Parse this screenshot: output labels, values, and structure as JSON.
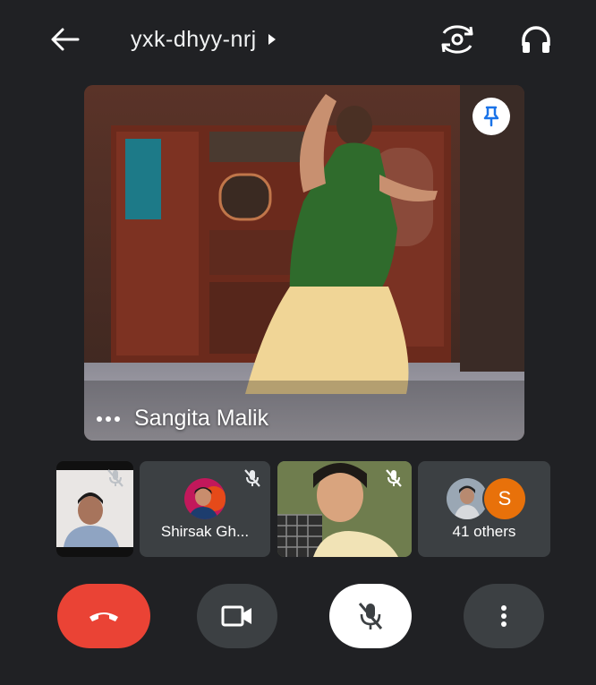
{
  "header": {
    "meeting_code": "yxk-dhyy-nrj",
    "back_icon": "arrow-back-icon",
    "title_caret_icon": "caret-right-icon",
    "switch_camera_icon": "camera-switch-icon",
    "audio_icon": "headphones-icon"
  },
  "main_tile": {
    "name": "Sangita Malik",
    "pin_icon": "pin-icon",
    "more_icon": "more-horiz-icon"
  },
  "participants": [
    {
      "name": "",
      "muted": true,
      "kind": "video"
    },
    {
      "name": "Shirsak Gh...",
      "muted": true,
      "kind": "avatar"
    },
    {
      "name": "",
      "muted": true,
      "kind": "video"
    },
    {
      "label": "41 others",
      "avatar_letter": "S",
      "kind": "others"
    }
  ],
  "controls": {
    "end_call_icon": "call-end-icon",
    "camera_icon": "videocam-icon",
    "mic_icon": "mic-off-icon",
    "more_icon": "more-vert-icon"
  },
  "colors": {
    "background": "#202124",
    "end_call": "#ea4335",
    "control": "#3c4043",
    "pin": "#1a73e8",
    "avatar_s": "#e8710a"
  }
}
